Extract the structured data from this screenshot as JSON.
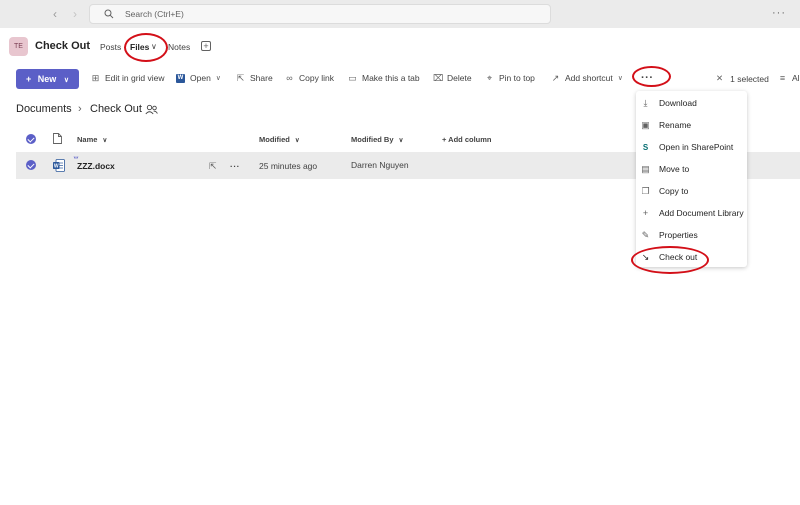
{
  "titlebar": {
    "search_placeholder": "Search (Ctrl+E)",
    "more": "···"
  },
  "header": {
    "avatar": "TE",
    "team_name": "Check Out",
    "tabs": [
      {
        "label": "Posts"
      },
      {
        "label": "Files"
      },
      {
        "label": "Notes"
      }
    ]
  },
  "toolbar": {
    "new_label": "New",
    "items": [
      {
        "label": "Edit in grid view",
        "icon": "grid-icon"
      },
      {
        "label": "Open",
        "icon": "word-icon"
      },
      {
        "label": "Share",
        "icon": "share-icon"
      },
      {
        "label": "Copy link",
        "icon": "link-icon"
      },
      {
        "label": "Make this a tab",
        "icon": "tab-icon"
      },
      {
        "label": "Delete",
        "icon": "trash-icon"
      },
      {
        "label": "Pin to top",
        "icon": "pin-icon"
      },
      {
        "label": "Add shortcut",
        "icon": "shortcut-icon"
      }
    ],
    "more": "···",
    "selected_text": "1 selected",
    "all_text": "Al"
  },
  "breadcrumb": {
    "root": "Documents",
    "current": "Check Out"
  },
  "table": {
    "headers": {
      "name": "Name",
      "modified": "Modified",
      "modified_by": "Modified By",
      "add_column": "+ Add column"
    },
    "rows": [
      {
        "name": "ZZZ.docx",
        "modified": "25 minutes ago",
        "modified_by": "Darren Nguyen",
        "more": "···"
      }
    ]
  },
  "menu": {
    "items": [
      {
        "label": "Download",
        "icon": "download-icon"
      },
      {
        "label": "Rename",
        "icon": "rename-icon"
      },
      {
        "label": "Open in SharePoint",
        "icon": "sharepoint-icon"
      },
      {
        "label": "Move to",
        "icon": "move-icon"
      },
      {
        "label": "Copy to",
        "icon": "copy-icon"
      },
      {
        "label": "Add Document Library",
        "icon": "plus-icon"
      },
      {
        "label": "Properties",
        "icon": "pencil-icon"
      },
      {
        "label": "Check out",
        "icon": "checkout-arrow-icon"
      }
    ]
  },
  "colors": {
    "accent": "#5b5fc7",
    "highlight_circle": "#d30f18",
    "selected_row": "#ebebeb"
  }
}
